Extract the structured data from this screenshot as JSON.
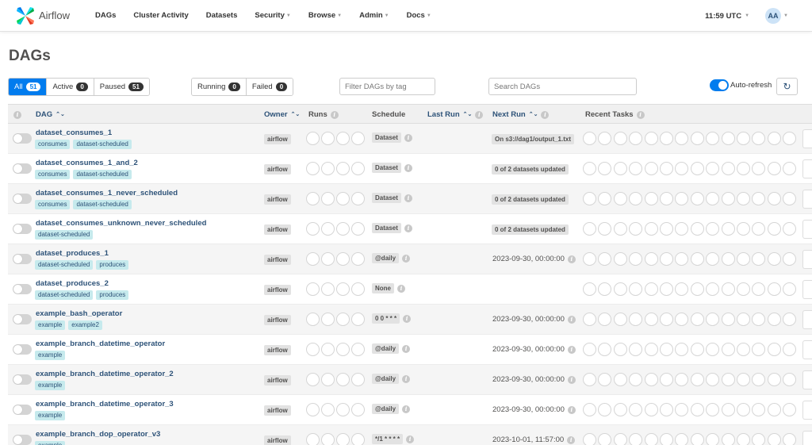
{
  "nav": {
    "brand": "Airflow",
    "items": [
      {
        "label": "DAGs",
        "dropdown": false
      },
      {
        "label": "Cluster Activity",
        "dropdown": false
      },
      {
        "label": "Datasets",
        "dropdown": false
      },
      {
        "label": "Security",
        "dropdown": true
      },
      {
        "label": "Browse",
        "dropdown": true
      },
      {
        "label": "Admin",
        "dropdown": true
      },
      {
        "label": "Docs",
        "dropdown": true
      }
    ],
    "clock": "11:59 UTC",
    "user_initials": "AA"
  },
  "page_title": "DAGs",
  "status_filter": {
    "all_label": "All",
    "all_count": "51",
    "active_label": "Active",
    "active_count": "0",
    "paused_label": "Paused",
    "paused_count": "51"
  },
  "run_filter": {
    "running_label": "Running",
    "running_count": "0",
    "failed_label": "Failed",
    "failed_count": "0"
  },
  "tag_filter_placeholder": "Filter DAGs by tag",
  "search_placeholder": "Search DAGs",
  "auto_refresh_label": "Auto-refresh",
  "table": {
    "headers": {
      "dag": "DAG",
      "owner": "Owner",
      "runs": "Runs",
      "schedule": "Schedule",
      "last_run": "Last Run",
      "next_run": "Next Run",
      "recent_tasks": "Recent Tasks"
    },
    "rows": [
      {
        "dag_id": "dataset_consumes_1",
        "tags": [
          "consumes",
          "dataset-scheduled"
        ],
        "owner": "airflow",
        "schedule": "Dataset",
        "next_run": "On s3://dag1/output_1.txt",
        "next_run_style": "badge",
        "next_run_info": false
      },
      {
        "dag_id": "dataset_consumes_1_and_2",
        "tags": [
          "consumes",
          "dataset-scheduled"
        ],
        "owner": "airflow",
        "schedule": "Dataset",
        "next_run": "0 of 2 datasets updated",
        "next_run_style": "badge",
        "next_run_info": false
      },
      {
        "dag_id": "dataset_consumes_1_never_scheduled",
        "tags": [
          "consumes",
          "dataset-scheduled"
        ],
        "owner": "airflow",
        "schedule": "Dataset",
        "next_run": "0 of 2 datasets updated",
        "next_run_style": "badge",
        "next_run_info": false
      },
      {
        "dag_id": "dataset_consumes_unknown_never_scheduled",
        "tags": [
          "dataset-scheduled"
        ],
        "owner": "airflow",
        "schedule": "Dataset",
        "next_run": "0 of 2 datasets updated",
        "next_run_style": "badge",
        "next_run_info": false
      },
      {
        "dag_id": "dataset_produces_1",
        "tags": [
          "dataset-scheduled",
          "produces"
        ],
        "owner": "airflow",
        "schedule": "@daily",
        "next_run": "2023-09-30, 00:00:00",
        "next_run_style": "text",
        "next_run_info": true
      },
      {
        "dag_id": "dataset_produces_2",
        "tags": [
          "dataset-scheduled",
          "produces"
        ],
        "owner": "airflow",
        "schedule": "None",
        "next_run": "",
        "next_run_style": "none",
        "next_run_info": false
      },
      {
        "dag_id": "example_bash_operator",
        "tags": [
          "example",
          "example2"
        ],
        "owner": "airflow",
        "schedule": "0 0 * * *",
        "next_run": "2023-09-30, 00:00:00",
        "next_run_style": "text",
        "next_run_info": true
      },
      {
        "dag_id": "example_branch_datetime_operator",
        "tags": [
          "example"
        ],
        "owner": "airflow",
        "schedule": "@daily",
        "next_run": "2023-09-30, 00:00:00",
        "next_run_style": "text",
        "next_run_info": true
      },
      {
        "dag_id": "example_branch_datetime_operator_2",
        "tags": [
          "example"
        ],
        "owner": "airflow",
        "schedule": "@daily",
        "next_run": "2023-09-30, 00:00:00",
        "next_run_style": "text",
        "next_run_info": true
      },
      {
        "dag_id": "example_branch_datetime_operator_3",
        "tags": [
          "example"
        ],
        "owner": "airflow",
        "schedule": "@daily",
        "next_run": "2023-09-30, 00:00:00",
        "next_run_style": "text",
        "next_run_info": true
      },
      {
        "dag_id": "example_branch_dop_operator_v3",
        "tags": [
          "example"
        ],
        "owner": "airflow",
        "schedule": "*/1 * * * *",
        "next_run": "2023-10-01, 11:57:00",
        "next_run_style": "text",
        "next_run_info": true
      }
    ]
  },
  "colors": {
    "accent": "#017cee",
    "link": "#2d5278",
    "tag_bg": "#c6eaed"
  },
  "icons": {
    "refresh": "refresh-icon",
    "info": "info-icon",
    "sort": "sort-icon"
  }
}
